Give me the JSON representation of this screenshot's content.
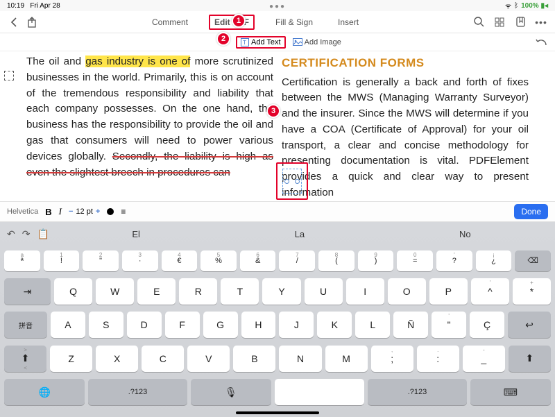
{
  "status": {
    "time": "10:19",
    "date": "Fri Apr 28",
    "bt": "✳",
    "battery": "100%"
  },
  "toolbar": {
    "tabs": {
      "comment": "Comment",
      "edit": "Edit PDF",
      "fillsign": "Fill & Sign",
      "insert": "Insert"
    }
  },
  "subbar": {
    "addtext": "Add Text",
    "addimage": "Add Image"
  },
  "markers": {
    "m1": "1",
    "m2": "2",
    "m3": "3"
  },
  "doc": {
    "left_hl_part1": "The oil and ",
    "left_hl_highlight": "gas industry is one of",
    "left_hl_part2": " more scrutinized businesses in the world. Primarily, this is on account of the tremendous responsibility and liability that each company possesses. On the one hand, the business has the responsibility to provide the oil and gas that consumers will need to power various devices globally. ",
    "left_strike": "Secondly, the liability is high as even the slightest breech in procedures can",
    "right_title": "CERTIFICATION FORMS",
    "right_body": "Certification is generally a back and forth of fixes between the MWS (Managing Warranty Surveyor) and the insurer. Since the MWS will determine if you have a COA (Certificate of Approval) for your oil transport, a clear and concise methodology for presenting documentation is vital. PDFElement provides a quick and clear way to present information"
  },
  "formatbar": {
    "font": "Helvetica",
    "bold": "B",
    "italic": "I",
    "size": "12 pt",
    "done": "Done"
  },
  "keyboard": {
    "sugg": [
      "El",
      "La",
      "No"
    ],
    "row0": [
      {
        "main": "ª",
        "sub": "a"
      },
      {
        "main": "!",
        "sub": "1"
      },
      {
        "main": "\"",
        "sub": "2"
      },
      {
        "main": "·",
        "sub": "3"
      },
      {
        "main": "€",
        "sub": "4"
      },
      {
        "main": "%",
        "sub": "5"
      },
      {
        "main": "&",
        "sub": "6"
      },
      {
        "main": "/",
        "sub": "7"
      },
      {
        "main": "(",
        "sub": "8"
      },
      {
        "main": ")",
        "sub": "9"
      },
      {
        "main": "=",
        "sub": "0"
      },
      {
        "main": "?",
        "sub": "'"
      },
      {
        "main": "¿",
        "sub": "¡"
      },
      {
        "main": "⌫",
        "sub": ""
      }
    ],
    "row1": [
      "Q",
      "W",
      "E",
      "R",
      "T",
      "Y",
      "U",
      "I",
      "O",
      "P"
    ],
    "row1_extra": [
      {
        "main": "^",
        "sub": "'"
      },
      {
        "main": "*",
        "sub": "+"
      }
    ],
    "row2_lead": "拼音",
    "row2": [
      "A",
      "S",
      "D",
      "F",
      "G",
      "H",
      "J",
      "K",
      "L",
      "Ñ"
    ],
    "row2_extra": [
      {
        "main": "\"",
        "sub": "'"
      },
      {
        "main": "Ç",
        "sub": ""
      }
    ],
    "row3": [
      "Z",
      "X",
      "C",
      "V",
      "B",
      "N",
      "M"
    ],
    "row3_extra": [
      {
        "main": ";",
        "sub": ","
      },
      {
        "main": ":",
        "sub": "."
      },
      {
        "main": "_",
        "sub": "-"
      }
    ],
    "row4": {
      "sym": ".?123",
      "mic": "🎤",
      "space": "",
      "sym2": ".?123"
    }
  }
}
